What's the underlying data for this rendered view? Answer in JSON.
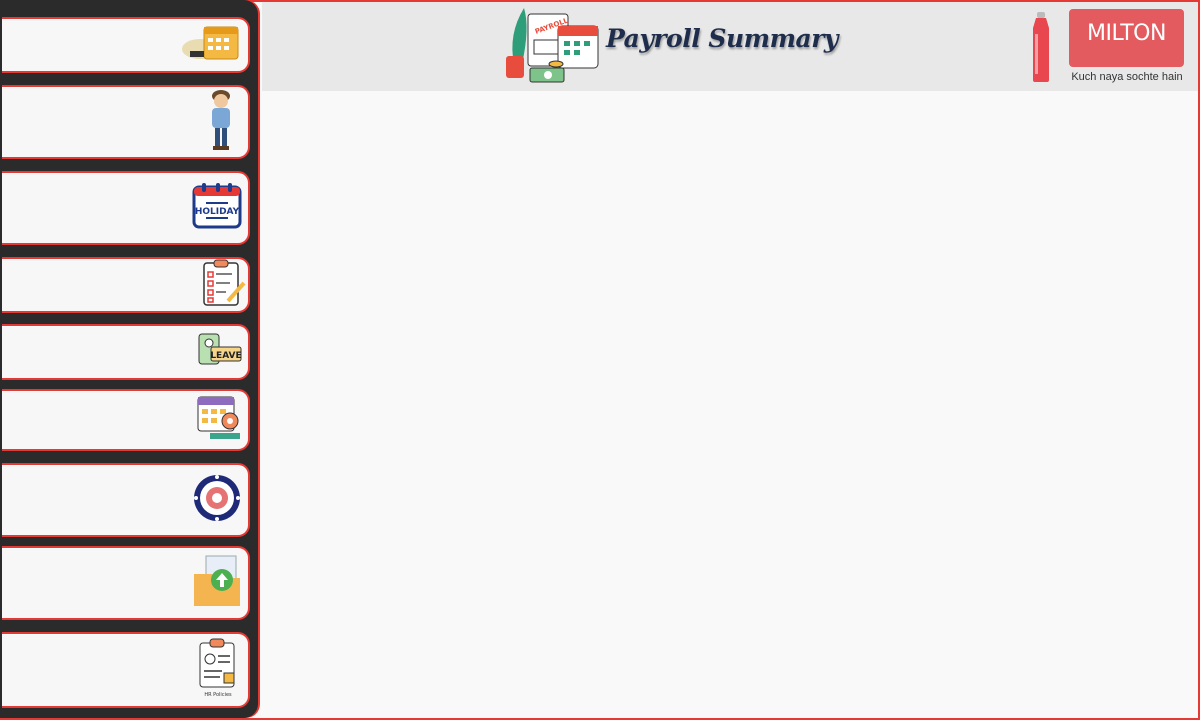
{
  "header": {
    "title": "Payroll Summary",
    "brand": {
      "name": "MILTON",
      "tagline": "Kuch naya sochte hain"
    }
  },
  "sidebar": {
    "items": [
      {
        "icon": "calendar-money-icon"
      },
      {
        "icon": "employee-avatar-icon"
      },
      {
        "icon": "holiday-calendar-icon",
        "icon_text": "HOLIDAY"
      },
      {
        "icon": "checklist-clipboard-icon"
      },
      {
        "icon": "leave-id-card-icon",
        "icon_text": "LEAVE"
      },
      {
        "icon": "calendar-settings-icon"
      },
      {
        "icon": "epfo-emblem-icon"
      },
      {
        "icon": "upload-folder-icon"
      },
      {
        "icon": "policy-document-icon",
        "icon_text": "HR Policies"
      }
    ]
  },
  "colors": {
    "accent": "#e53935",
    "sidebar_bg": "#2b2b2b",
    "title_color": "#1f2d4d",
    "brand_bg": "#e35a5f"
  }
}
